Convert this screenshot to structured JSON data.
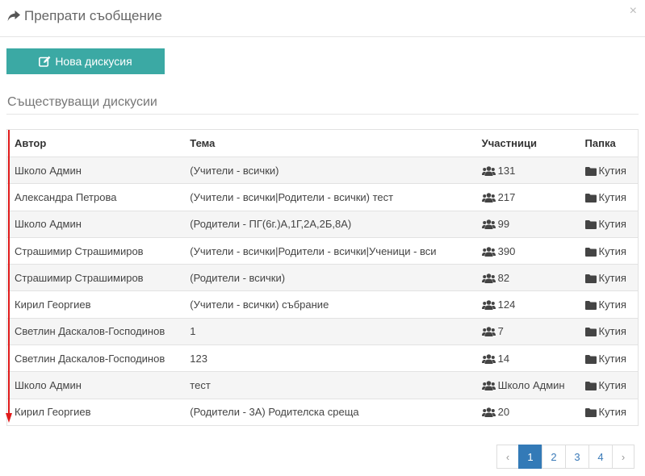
{
  "modal": {
    "title": "Препрати съобщение",
    "close": "×"
  },
  "new_button": {
    "label": "Нова дискусия"
  },
  "section": {
    "title": "Съществуващи дискусии"
  },
  "table": {
    "headers": {
      "author": "Автор",
      "topic": "Тема",
      "participants": "Участници",
      "folder": "Папка"
    },
    "rows": [
      {
        "author": "Школо Админ",
        "topic": "(Учители - всички)",
        "participants": "131",
        "folder": "Кутия"
      },
      {
        "author": "Александра Петрова",
        "topic": "(Учители - всички|Родители - всички) тест",
        "participants": "217",
        "folder": "Кутия"
      },
      {
        "author": "Школо Админ",
        "topic": "(Родители - ПГ(6г.)А,1Г,2А,2Б,8А)",
        "participants": "99",
        "folder": "Кутия"
      },
      {
        "author": "Страшимир Страшимиров",
        "topic": "(Учители - всички|Родители - всички|Ученици - вси",
        "participants": "390",
        "folder": "Кутия"
      },
      {
        "author": "Страшимир Страшимиров",
        "topic": "(Родители - всички)",
        "participants": "82",
        "folder": "Кутия"
      },
      {
        "author": "Кирил Георгиев",
        "topic": "(Учители - всички) събрание",
        "participants": "124",
        "folder": "Кутия"
      },
      {
        "author": "Светлин Даскалов-Господинов",
        "topic": "1",
        "participants": "7",
        "folder": "Кутия"
      },
      {
        "author": "Светлин Даскалов-Господинов",
        "topic": "123",
        "participants": "14",
        "folder": "Кутия"
      },
      {
        "author": "Школо Админ",
        "topic": "тест",
        "participants": "Школо Админ",
        "folder": "Кутия"
      },
      {
        "author": "Кирил Георгиев",
        "topic": "(Родители - 3А) Родителска среща",
        "participants": "20",
        "folder": "Кутия"
      }
    ]
  },
  "pagination": {
    "prev": "‹",
    "pages": [
      "1",
      "2",
      "3",
      "4"
    ],
    "next": "›",
    "current": "1"
  },
  "colors": {
    "accent": "#3ba9a4",
    "pager_active": "#337ab7",
    "annotation_arrow": "#e01b1b"
  },
  "icons": {
    "title": "share-icon",
    "button": "edit-icon",
    "participants": "users-icon",
    "folder": "folder-icon"
  }
}
